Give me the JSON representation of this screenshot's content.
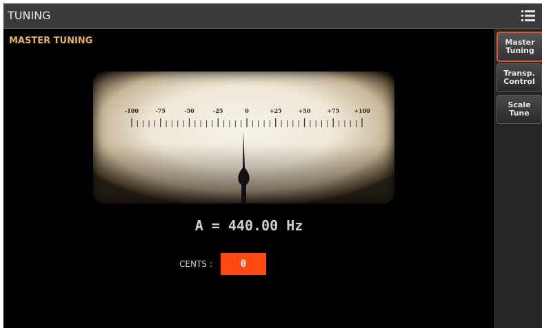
{
  "header": {
    "title": "TUNING",
    "menu_icon": "list-menu-icon"
  },
  "section": {
    "title": "MASTER TUNING"
  },
  "tabs": [
    {
      "label": "Master\nTuning",
      "active": true
    },
    {
      "label": "Transp.\nControl",
      "active": false
    },
    {
      "label": "Scale\nTune",
      "active": false
    }
  ],
  "meter": {
    "scale_labels": [
      "-100",
      "-75",
      "-50",
      "-25",
      "0",
      "+25",
      "+50",
      "+75",
      "+100"
    ],
    "needle_value": 0
  },
  "frequency": {
    "note": "A",
    "equals": "=",
    "value": "440.00",
    "unit": "Hz"
  },
  "cents": {
    "label": "CENTS :",
    "value": "0"
  },
  "colors": {
    "accent": "#ff4a12",
    "section_title": "#e7b45a",
    "active_tab_border": "#e3542e"
  }
}
